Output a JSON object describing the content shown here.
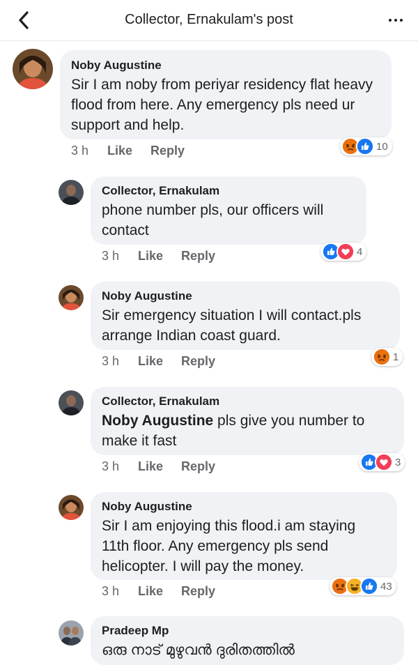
{
  "header": {
    "title": "Collector, Ernakulam's post"
  },
  "comments": [
    {
      "author": "Noby Augustine",
      "text": "Sir I am noby from periyar residency flat heavy flood from here. Any emergency pls need ur support and help.",
      "time": "3 h",
      "like": "Like",
      "reply": "Reply",
      "reactions": [
        "angry",
        "like"
      ],
      "reaction_count": "10"
    },
    {
      "author": "Collector, Ernakulam",
      "text": "phone number pls, our officers will contact",
      "time": "3 h",
      "like": "Like",
      "reply": "Reply",
      "reactions": [
        "like",
        "love"
      ],
      "reaction_count": "4"
    },
    {
      "author": "Noby Augustine",
      "text": "Sir emergency situation I will contact.pls arrange Indian coast guard.",
      "time": "3 h",
      "like": "Like",
      "reply": "Reply",
      "reactions": [
        "angry"
      ],
      "reaction_count": "1"
    },
    {
      "author": "Collector, Ernakulam",
      "mention": "Noby Augustine",
      "text": " pls give you number to make it fast",
      "time": "3 h",
      "like": "Like",
      "reply": "Reply",
      "reactions": [
        "like",
        "love"
      ],
      "reaction_count": "3"
    },
    {
      "author": "Noby Augustine",
      "text": "Sir I am enjoying this flood.i am staying 11th floor. Any emergency  pls send helicopter. I will pay the money.",
      "time": "3 h",
      "like": "Like",
      "reply": "Reply",
      "reactions": [
        "angry",
        "haha",
        "like"
      ],
      "reaction_count": "43"
    },
    {
      "author": "Pradeep Mp",
      "text": "ഒരു നാട് മുഴുവൻ ദുരിതത്തിൽ"
    }
  ],
  "colors": {
    "bubble": "#f0f2f5",
    "meta_text": "#65676b",
    "like_blue": "#1877f2",
    "love_red": "#f33e58",
    "angry_orange": "#e9710f",
    "haha_yellow": "#f7b125"
  }
}
